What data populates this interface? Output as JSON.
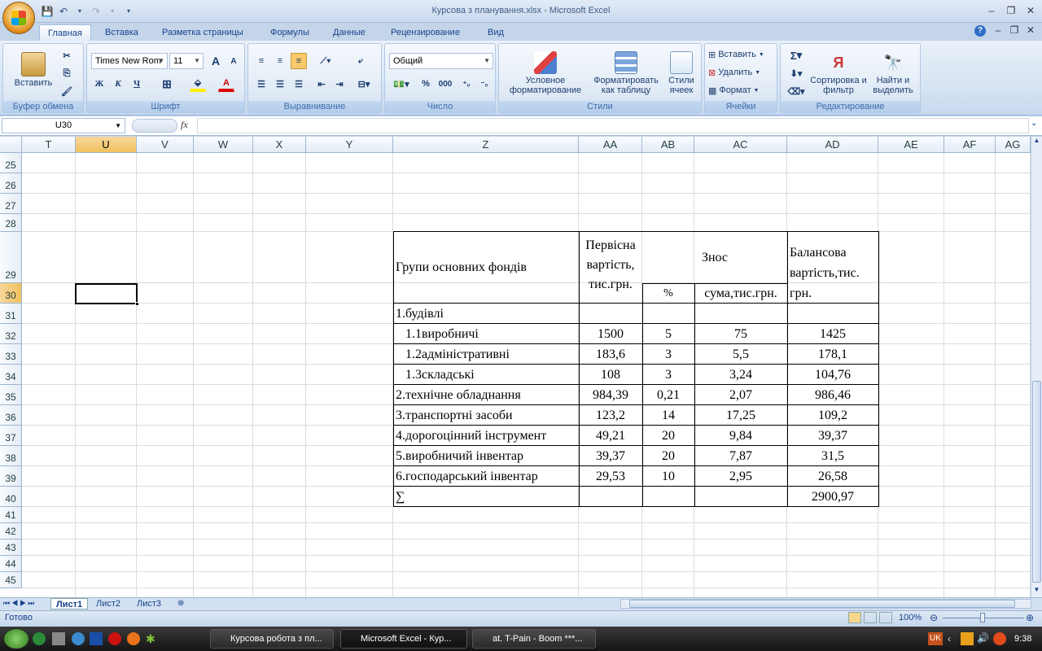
{
  "window": {
    "title": "Курсова з планування.xlsx - Microsoft Excel"
  },
  "tabs": [
    "Главная",
    "Вставка",
    "Разметка страницы",
    "Формулы",
    "Данные",
    "Рецензирование",
    "Вид"
  ],
  "ribbon": {
    "clipboard": {
      "paste": "Вставить",
      "label": "Буфер обмена"
    },
    "font": {
      "name": "Times New Rom",
      "size": "11",
      "bold": "Ж",
      "italic": "К",
      "underline": "Ч",
      "label": "Шрифт",
      "grow": "A",
      "shrink": "A"
    },
    "alignment": {
      "label": "Выравнивание"
    },
    "number": {
      "format": "Общий",
      "percent": "%",
      "thousands": "000",
      "label": "Число"
    },
    "styles": {
      "conditional": "Условное форматирование",
      "as_table": "Форматировать как таблицу",
      "cell_styles": "Стили ячеек",
      "label": "Стили"
    },
    "cells": {
      "insert": "Вставить",
      "delete": "Удалить",
      "format": "Формат",
      "label": "Ячейки"
    },
    "editing": {
      "sigma": "Σ",
      "sort": "Сортировка и фильтр",
      "find": "Найти и выделить",
      "label": "Редактирование"
    }
  },
  "formula_bar": {
    "name_box": "U30",
    "fx": "fx",
    "value": ""
  },
  "columns": [
    "T",
    "U",
    "V",
    "W",
    "X",
    "Y",
    "Z",
    "AA",
    "AB",
    "AC",
    "AD",
    "AE",
    "AF",
    "AG"
  ],
  "selected_column": "U",
  "rows": [
    "25",
    "26",
    "27",
    "28",
    "29",
    "30",
    "31",
    "32",
    "33",
    "34",
    "35",
    "36",
    "37",
    "38",
    "39",
    "40",
    "41",
    "42",
    "43",
    "44",
    "45"
  ],
  "selected_row": "30",
  "table": {
    "header": {
      "group": "Групи основних фондів",
      "initial_line1": "Первісна",
      "initial_line2": "вартість,",
      "initial_line3": "тис.грн.",
      "wear": "Знос",
      "percent": "%",
      "sum": "сума,тис.грн.",
      "balance_line1": "Балансова",
      "balance_line2": "вартість,тис.",
      "balance_line3": "грн."
    },
    "rows": [
      {
        "name": "1.будівлі",
        "initial": "",
        "pct": "",
        "sum": "",
        "balance": ""
      },
      {
        "name": "   1.1виробничі",
        "initial": "1500",
        "pct": "5",
        "sum": "75",
        "balance": "1425"
      },
      {
        "name": "   1.2адміністративні",
        "initial": "183,6",
        "pct": "3",
        "sum": "5,5",
        "balance": "178,1"
      },
      {
        "name": "   1.3складські",
        "initial": "108",
        "pct": "3",
        "sum": "3,24",
        "balance": "104,76"
      },
      {
        "name": "2.технічне обладнання",
        "initial": "984,39",
        "pct": "0,21",
        "sum": "2,07",
        "balance": "986,46"
      },
      {
        "name": "3.транспортні засоби",
        "initial": "123,2",
        "pct": "14",
        "sum": "17,25",
        "balance": "109,2"
      },
      {
        "name": "4.дорогоцінний інструмент",
        "initial": "49,21",
        "pct": "20",
        "sum": "9,84",
        "balance": "39,37"
      },
      {
        "name": "5.виробничий інвентар",
        "initial": "39,37",
        "pct": "20",
        "sum": "7,87",
        "balance": "31,5"
      },
      {
        "name": "6.господарський інвентар",
        "initial": "29,53",
        "pct": "10",
        "sum": "2,95",
        "balance": "26,58"
      },
      {
        "name": "∑",
        "initial": "",
        "pct": "",
        "sum": "",
        "balance": "2900,97"
      }
    ]
  },
  "sheets": [
    "Лист1",
    "Лист2",
    "Лист3"
  ],
  "active_sheet": "Лист1",
  "status": {
    "ready": "Готово",
    "zoom": "100%"
  },
  "taskbar": {
    "items": [
      "Курсова робота з пл...",
      "Microsoft Excel - Кур...",
      "at. T-Pain - Boom ***..."
    ],
    "lang": "UK",
    "time": "9:38"
  }
}
